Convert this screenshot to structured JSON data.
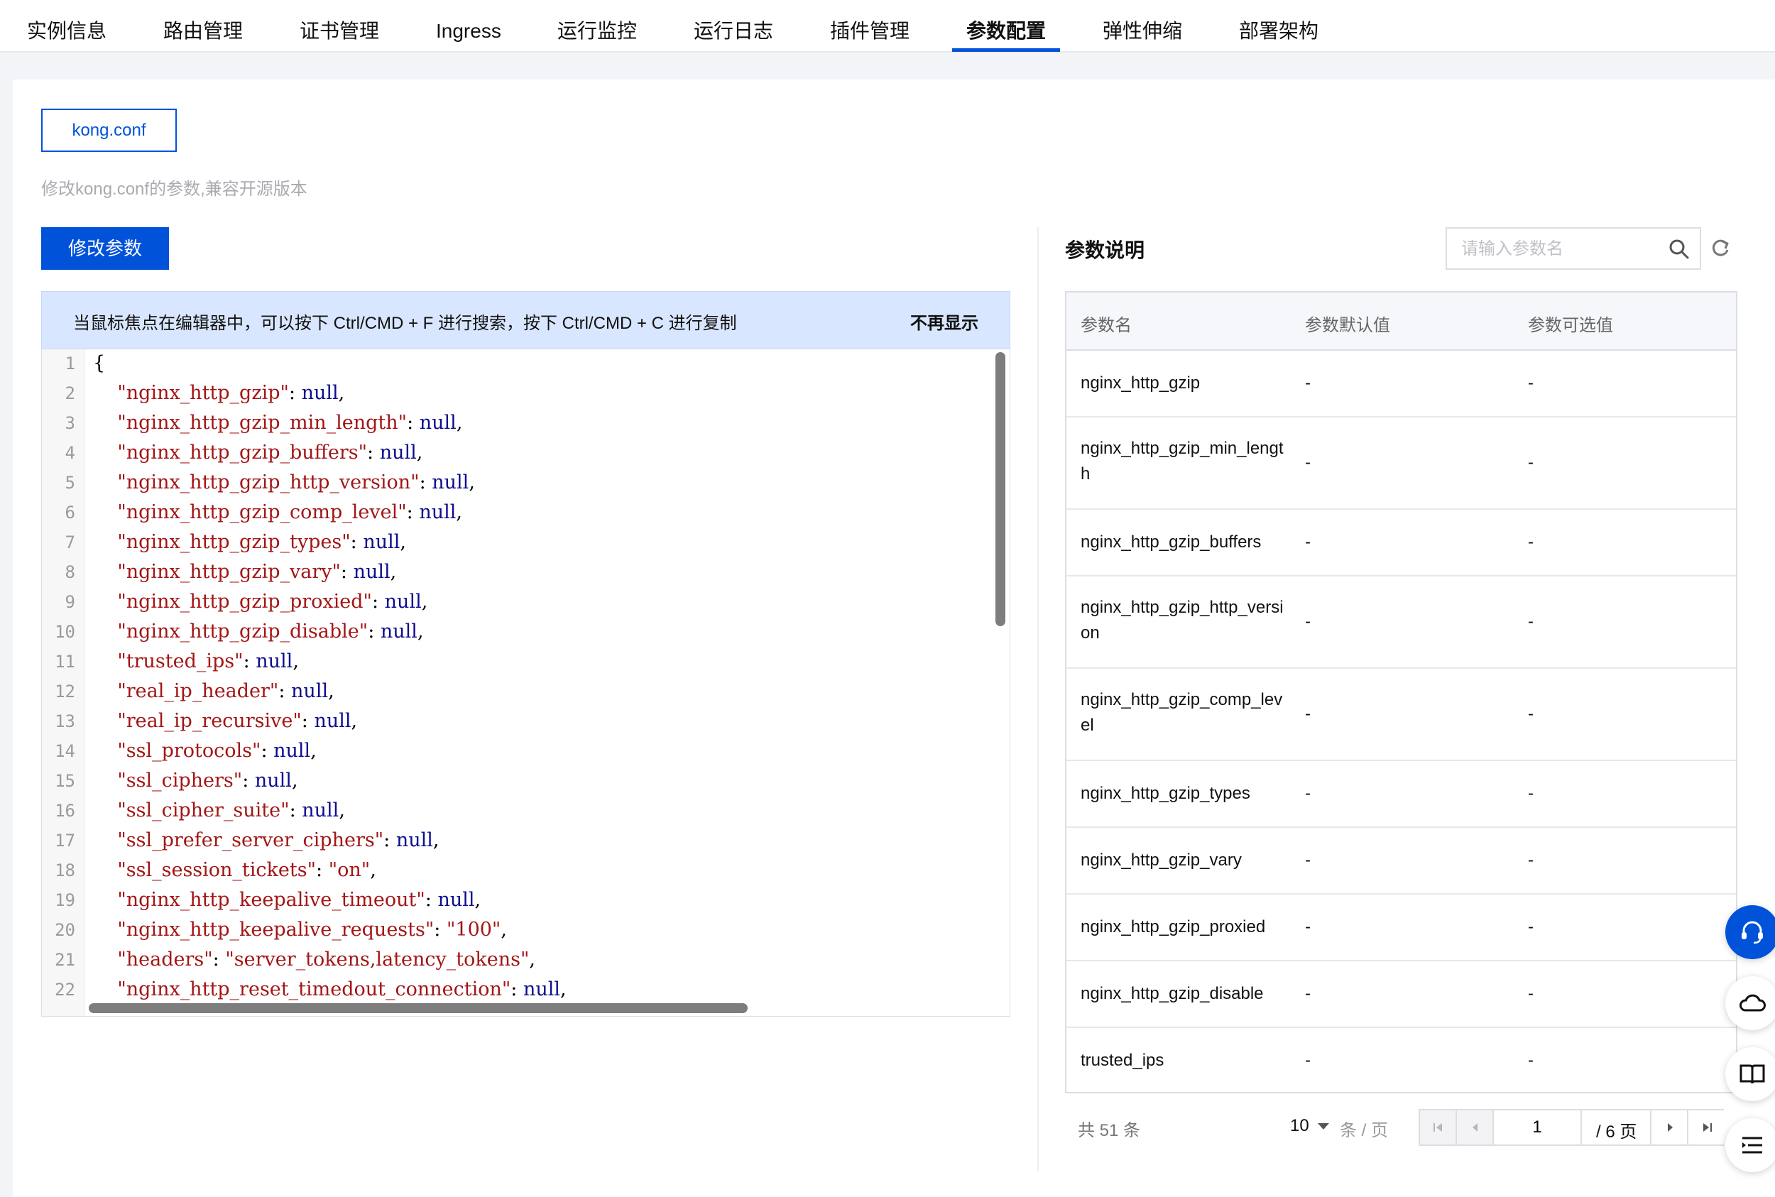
{
  "tabs": [
    {
      "label": "实例信息",
      "active": false
    },
    {
      "label": "路由管理",
      "active": false
    },
    {
      "label": "证书管理",
      "active": false
    },
    {
      "label": "Ingress",
      "active": false
    },
    {
      "label": "运行监控",
      "active": false
    },
    {
      "label": "运行日志",
      "active": false
    },
    {
      "label": "插件管理",
      "active": false
    },
    {
      "label": "参数配置",
      "active": true
    },
    {
      "label": "弹性伸缩",
      "active": false
    },
    {
      "label": "部署架构",
      "active": false
    }
  ],
  "config": {
    "file_tab": "kong.conf",
    "description": "修改kong.conf的参数,兼容开源版本",
    "edit_button": "修改参数"
  },
  "notice": {
    "text": "当鼠标焦点在编辑器中，可以按下 Ctrl/CMD + F 进行搜索，按下 Ctrl/CMD + C 进行复制",
    "dismiss": "不再显示"
  },
  "editor": {
    "lines": [
      {
        "no": "1",
        "key": "",
        "value": "",
        "open": "{"
      },
      {
        "no": "2",
        "key": "\"nginx_http_gzip\"",
        "value": "null"
      },
      {
        "no": "3",
        "key": "\"nginx_http_gzip_min_length\"",
        "value": "null"
      },
      {
        "no": "4",
        "key": "\"nginx_http_gzip_buffers\"",
        "value": "null"
      },
      {
        "no": "5",
        "key": "\"nginx_http_gzip_http_version\"",
        "value": "null"
      },
      {
        "no": "6",
        "key": "\"nginx_http_gzip_comp_level\"",
        "value": "null"
      },
      {
        "no": "7",
        "key": "\"nginx_http_gzip_types\"",
        "value": "null"
      },
      {
        "no": "8",
        "key": "\"nginx_http_gzip_vary\"",
        "value": "null"
      },
      {
        "no": "9",
        "key": "\"nginx_http_gzip_proxied\"",
        "value": "null"
      },
      {
        "no": "10",
        "key": "\"nginx_http_gzip_disable\"",
        "value": "null"
      },
      {
        "no": "11",
        "key": "\"trusted_ips\"",
        "value": "null"
      },
      {
        "no": "12",
        "key": "\"real_ip_header\"",
        "value": "null"
      },
      {
        "no": "13",
        "key": "\"real_ip_recursive\"",
        "value": "null"
      },
      {
        "no": "14",
        "key": "\"ssl_protocols\"",
        "value": "null"
      },
      {
        "no": "15",
        "key": "\"ssl_ciphers\"",
        "value": "null"
      },
      {
        "no": "16",
        "key": "\"ssl_cipher_suite\"",
        "value": "null"
      },
      {
        "no": "17",
        "key": "\"ssl_prefer_server_ciphers\"",
        "value": "null"
      },
      {
        "no": "18",
        "key": "\"ssl_session_tickets\"",
        "value": "\"on\"",
        "string": true
      },
      {
        "no": "19",
        "key": "\"nginx_http_keepalive_timeout\"",
        "value": "null"
      },
      {
        "no": "20",
        "key": "\"nginx_http_keepalive_requests\"",
        "value": "\"100\"",
        "string": true
      },
      {
        "no": "21",
        "key": "\"headers\"",
        "value": "\"server_tokens,latency_tokens\"",
        "string": true
      },
      {
        "no": "22",
        "key": "\"nginx_http_reset_timedout_connection\"",
        "value": "null"
      }
    ]
  },
  "params": {
    "title": "参数说明",
    "search_placeholder": "请输入参数名",
    "columns": [
      "参数名",
      "参数默认值",
      "参数可选值"
    ],
    "rows": [
      {
        "name": "nginx_http_gzip",
        "default": "-",
        "options": "-"
      },
      {
        "name": "nginx_http_gzip_min_length",
        "default": "-",
        "options": "-"
      },
      {
        "name": "nginx_http_gzip_buffers",
        "default": "-",
        "options": "-"
      },
      {
        "name": "nginx_http_gzip_http_version",
        "default": "-",
        "options": "-"
      },
      {
        "name": "nginx_http_gzip_comp_level",
        "default": "-",
        "options": "-"
      },
      {
        "name": "nginx_http_gzip_types",
        "default": "-",
        "options": "-"
      },
      {
        "name": "nginx_http_gzip_vary",
        "default": "-",
        "options": "-"
      },
      {
        "name": "nginx_http_gzip_proxied",
        "default": "-",
        "options": "-"
      },
      {
        "name": "nginx_http_gzip_disable",
        "default": "-",
        "options": "-"
      },
      {
        "name": "trusted_ips",
        "default": "-",
        "options": "-"
      }
    ]
  },
  "pagination": {
    "total": "共 51 条",
    "page_size": "10",
    "unit": "条 / 页",
    "current_page": "1",
    "total_pages": "/ 6 页"
  },
  "float_icons": [
    "headset-icon",
    "cloud-icon",
    "book-icon",
    "list-icon"
  ]
}
